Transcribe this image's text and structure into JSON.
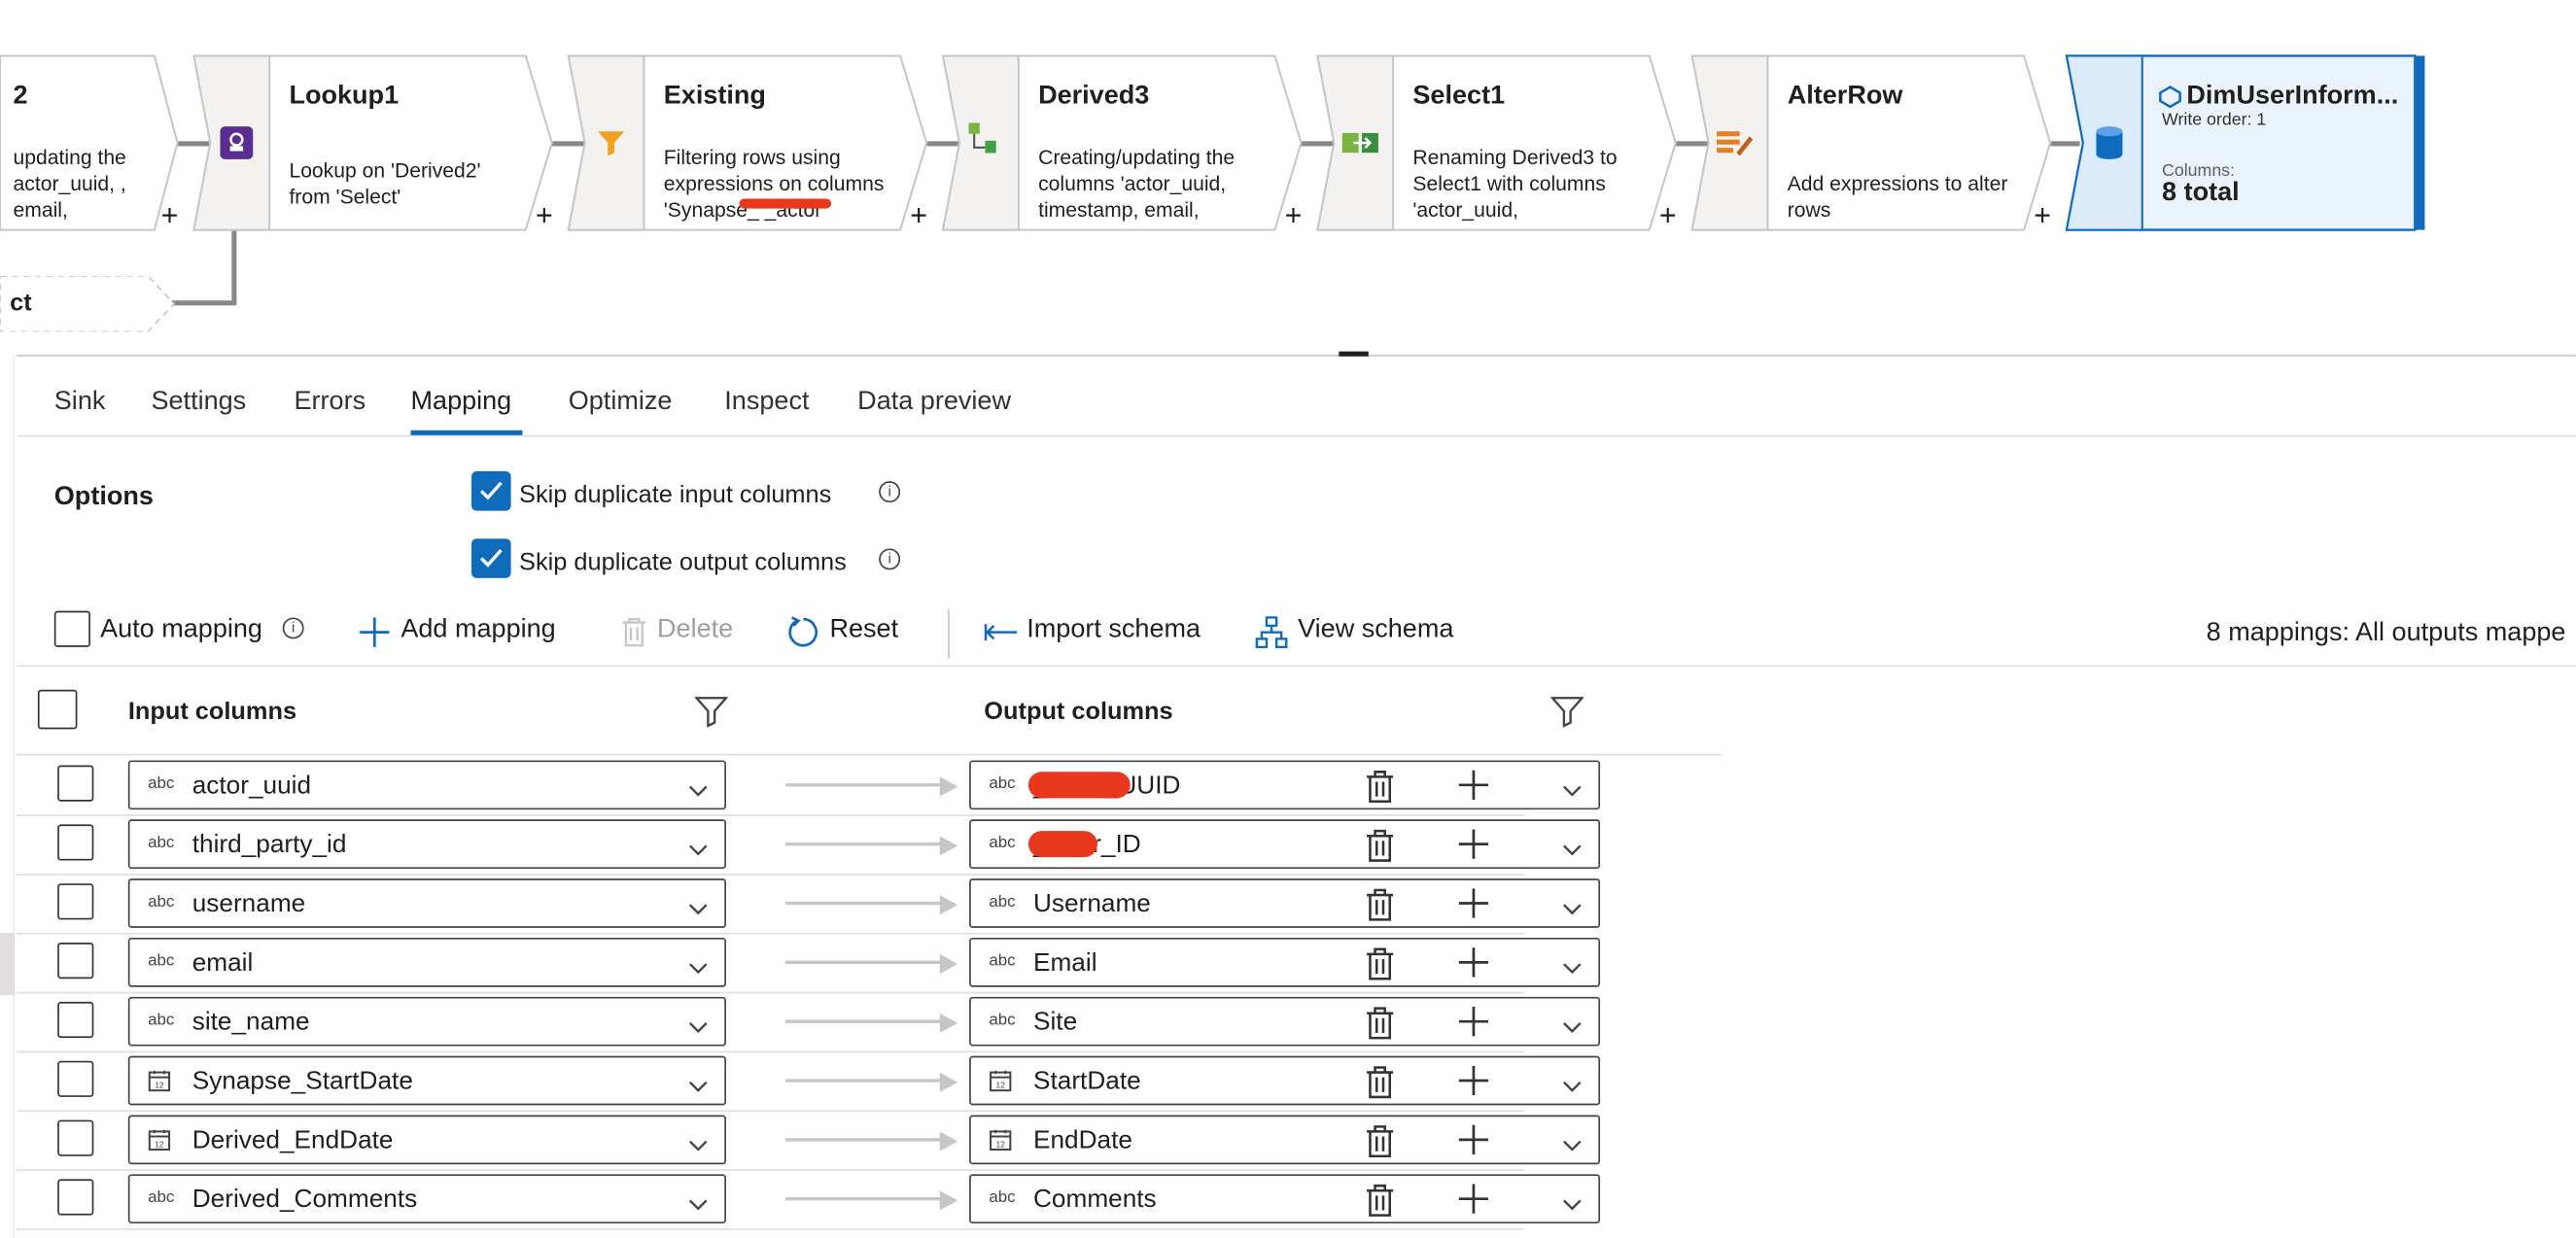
{
  "pipeline": {
    "nodes": [
      {
        "title": "2",
        "desc": "updating the actor_uuid, , email,"
      },
      {
        "title": "Lookup1",
        "desc": "Lookup on 'Derived2' from 'Select'"
      },
      {
        "title": "Existing",
        "desc": "Filtering rows using expressions on columns 'Synapse_ _actor"
      },
      {
        "title": "Derived3",
        "desc": "Creating/updating the columns 'actor_uuid, timestamp, email,"
      },
      {
        "title": "Select1",
        "desc": "Renaming Derived3 to Select1 with columns 'actor_uuid,"
      },
      {
        "title": "AlterRow",
        "desc": "Add expressions to alter rows"
      }
    ],
    "sink": {
      "title": "DimUserInform...",
      "write_order": "Write order: 1",
      "columns_label": "Columns:",
      "columns_value": "8 total"
    },
    "ghost_label": "ct",
    "plus": "+"
  },
  "tabs": [
    "Sink",
    "Settings",
    "Errors",
    "Mapping",
    "Optimize",
    "Inspect",
    "Data preview"
  ],
  "active_tab": "Mapping",
  "options": {
    "label": "Options",
    "skip_input": "Skip duplicate input columns",
    "skip_output": "Skip duplicate output columns"
  },
  "toolbar": {
    "auto_mapping": "Auto mapping",
    "add_mapping": "Add mapping",
    "delete": "Delete",
    "reset": "Reset",
    "import_schema": "Import schema",
    "view_schema": "View schema",
    "status": "8 mappings: All outputs mappe"
  },
  "table": {
    "input_header": "Input columns",
    "output_header": "Output columns",
    "type_abc": "abc",
    "type_date": "12",
    "rows": [
      {
        "input": "actor_uuid",
        "output": "_actor_UUID",
        "type": "abc"
      },
      {
        "input": "third_party_id",
        "output": "_User_ID",
        "type": "abc"
      },
      {
        "input": "username",
        "output": "Username",
        "type": "abc"
      },
      {
        "input": "email",
        "output": "Email",
        "type": "abc"
      },
      {
        "input": "site_name",
        "output": "Site",
        "type": "abc"
      },
      {
        "input": "Synapse_StartDate",
        "output": "StartDate",
        "type": "date"
      },
      {
        "input": "Derived_EndDate",
        "output": "EndDate",
        "type": "date"
      },
      {
        "input": "Derived_Comments",
        "output": "Comments",
        "type": "abc"
      }
    ]
  },
  "colors": {
    "accent": "#0f6cbd",
    "sink_bg": "#eaf3fc",
    "node_bg": "#f3f2f1",
    "redaction": "#e8391f"
  }
}
